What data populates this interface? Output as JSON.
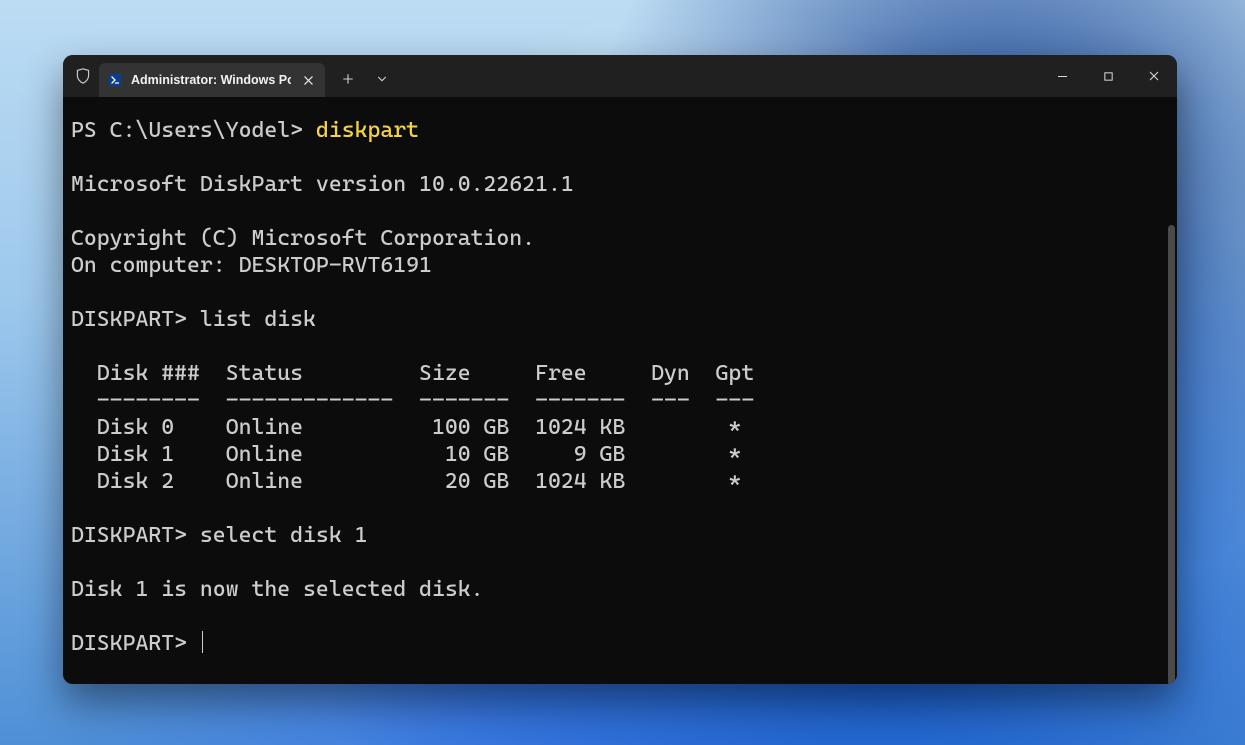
{
  "window": {
    "tab_title": "Administrator: Windows Powe"
  },
  "terminal": {
    "prompt1_prefix": "PS C:\\Users\\Yodel> ",
    "command1": "diskpart",
    "version_line": "Microsoft DiskPart version 10.0.22621.1",
    "copyright_line": "Copyright (C) Microsoft Corporation.",
    "computer_line": "On computer: DESKTOP-RVT6191",
    "dp_prompt1": "DISKPART> list disk",
    "table_header": "  Disk ###  Status         Size     Free     Dyn  Gpt",
    "table_divider": "  --------  -------------  -------  -------  ---  ---",
    "table_row0": "  Disk 0    Online          100 GB  1024 KB        *",
    "table_row1": "  Disk 1    Online           10 GB     9 GB        *",
    "table_row2": "  Disk 2    Online           20 GB  1024 KB        *",
    "dp_prompt2": "DISKPART> select disk 1",
    "select_result": "Disk 1 is now the selected disk.",
    "dp_prompt3": "DISKPART> "
  }
}
